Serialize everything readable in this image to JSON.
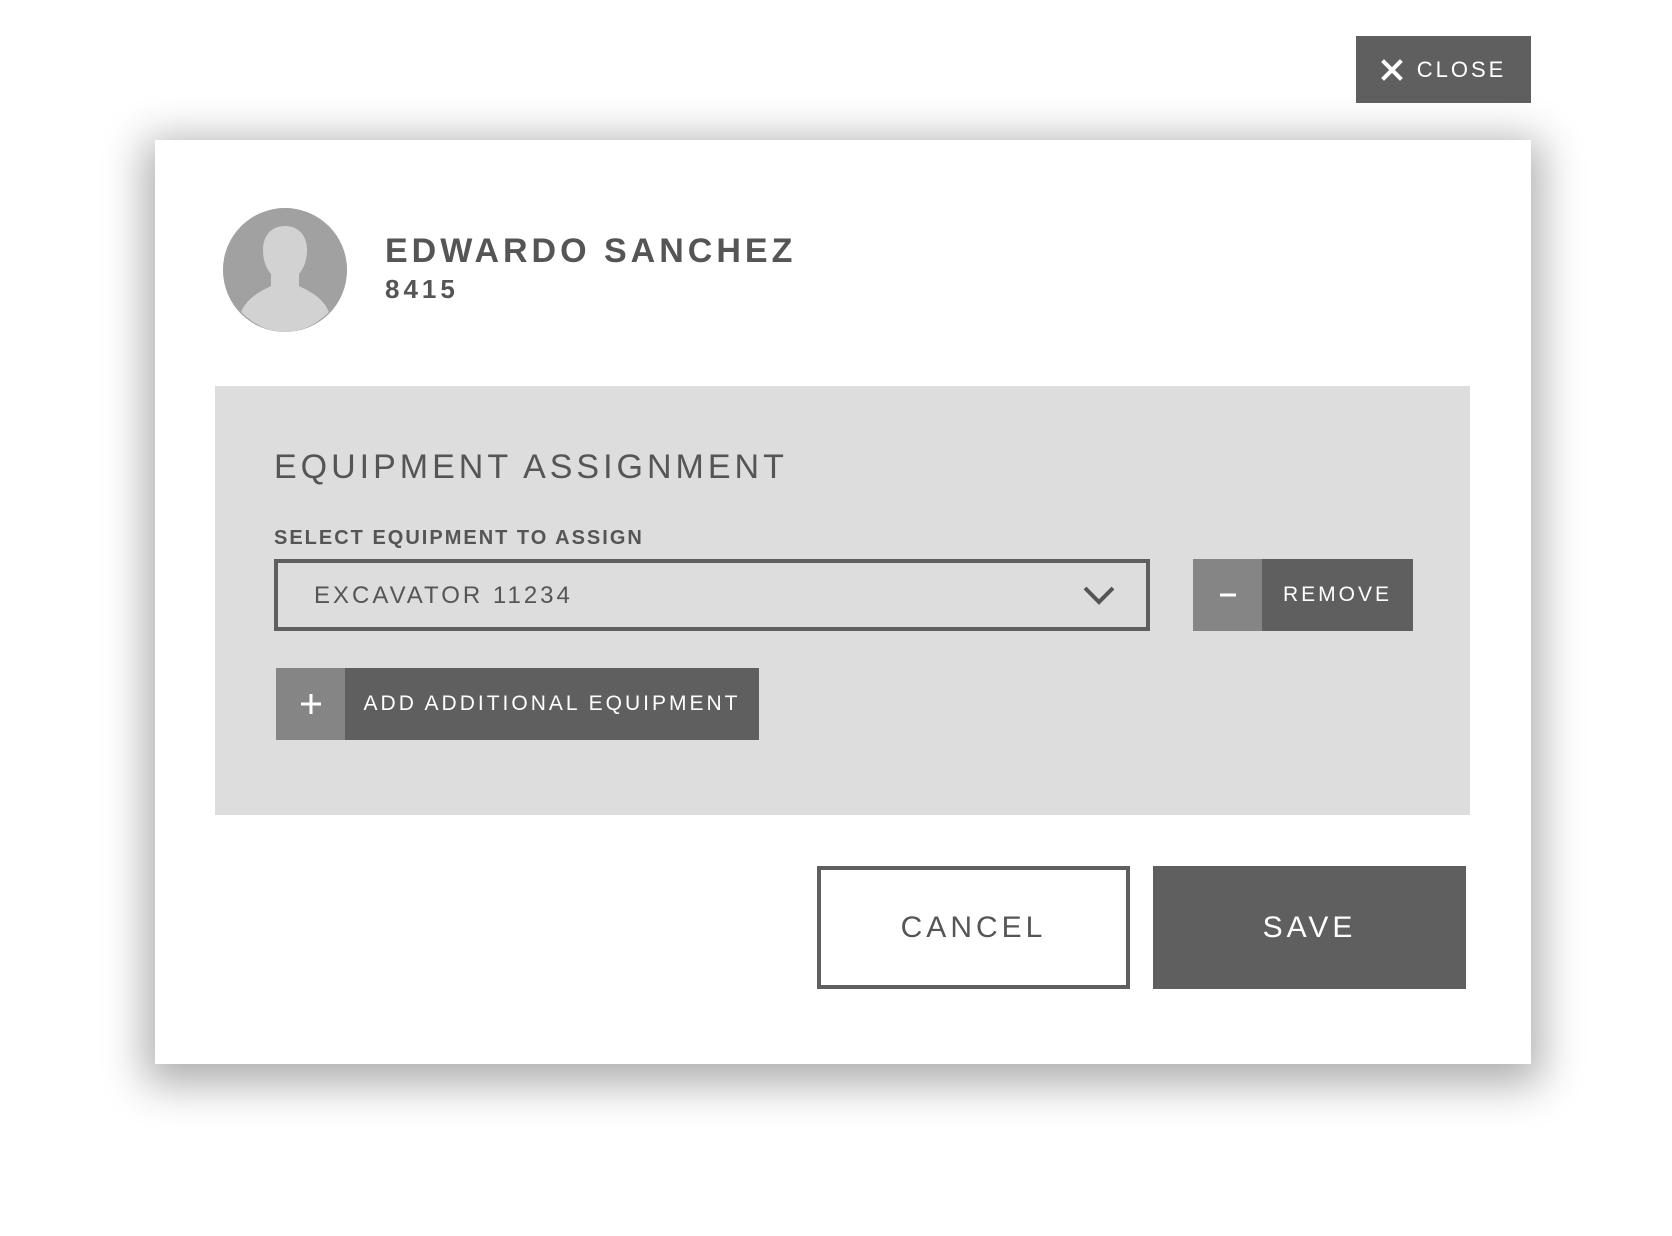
{
  "header": {
    "close_label": "CLOSE",
    "close_icon": "close-icon"
  },
  "user": {
    "name": "EDWARDO SANCHEZ",
    "id": "8415",
    "avatar_icon": "person-silhouette-icon"
  },
  "equipment": {
    "title": "EQUIPMENT ASSIGNMENT",
    "select_label": "SELECT EQUIPMENT TO ASSIGN",
    "selected_value": "EXCAVATOR 11234",
    "remove_label": "REMOVE",
    "add_label": "ADD ADDITIONAL EQUIPMENT"
  },
  "footer": {
    "cancel_label": "CANCEL",
    "save_label": "SAVE"
  },
  "colors": {
    "dark_button": "#5f5f5f",
    "icon_box": "#858585",
    "panel_bg": "#dddddd",
    "text": "#555555"
  }
}
